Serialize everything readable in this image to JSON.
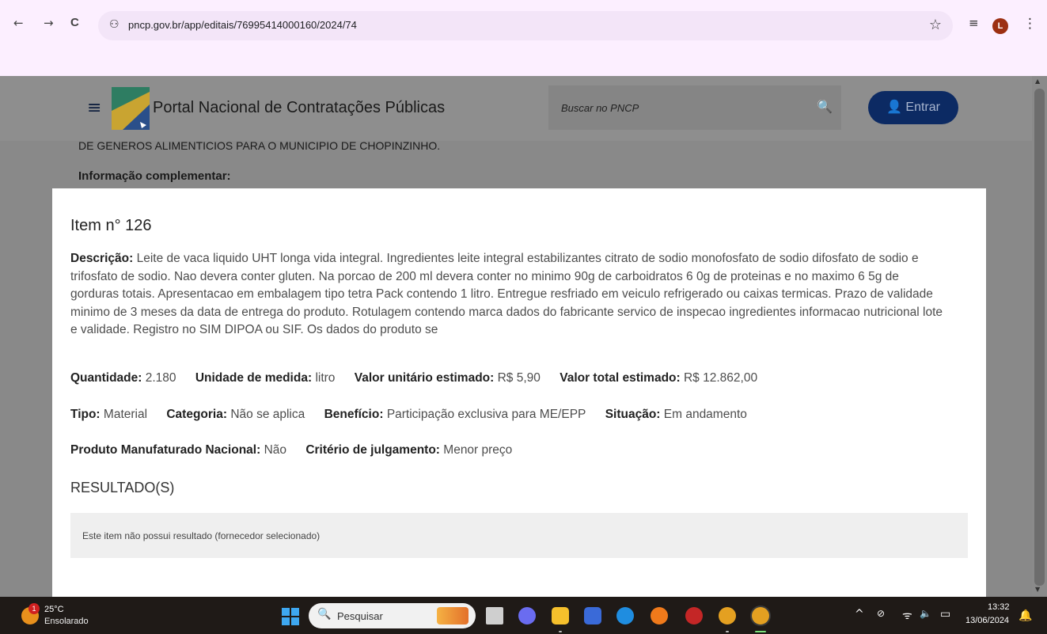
{
  "browser": {
    "url": "pncp.gov.br/app/editais/76995414000160/2024/74",
    "profile_initial": "L",
    "back_icon": "←",
    "forward_icon": "→",
    "reload_icon": "C",
    "tune_icon": "⚇",
    "star_icon": "☆",
    "reading_icon": "≡",
    "menu_icon": "⋮"
  },
  "header": {
    "menu_icon": "≡",
    "title": "Portal Nacional de Contratações Públicas",
    "search_placeholder": "Buscar no PNCP",
    "search_icon": "🔍",
    "login_label": "Entrar",
    "login_icon": "👤"
  },
  "background": {
    "partial_text": "DE GENEROS ALIMENTICIOS PARA O MUNICIPIO DE CHOPINZINHO.",
    "info_label": "Informação complementar:"
  },
  "modal": {
    "title": "Item n° 126",
    "description_label": "Descrição:",
    "description": "Leite de vaca liquido UHT longa vida integral. Ingredientes leite integral estabilizantes citrato de sodio monofosfato de sodio difosfato de sodio e trifosfato de sodio. Nao devera conter gluten. Na porcao de 200 ml devera conter no minimo 90g de carboidratos 6 0g de proteinas e no maximo 6 5g de gorduras totais. Apresentacao em embalagem tipo tetra Pack contendo 1 litro. Entregue resfriado em veiculo refrigerado ou caixas termicas. Prazo de validade minimo de 3 meses da data de entrega do produto. Rotulagem contendo marca dados do fabricante servico de inspecao ingredientes informacao nutricional lote e validade. Registro no SIM DIPOA ou SIF. Os dados do produto se",
    "quantidade_label": "Quantidade:",
    "quantidade": "2.180",
    "unidade_label": "Unidade de medida:",
    "unidade": "litro",
    "valor_unit_label": "Valor unitário estimado:",
    "valor_unit": "R$ 5,90",
    "valor_total_label": "Valor total estimado:",
    "valor_total": "R$ 12.862,00",
    "tipo_label": "Tipo:",
    "tipo": "Material",
    "categoria_label": "Categoria:",
    "categoria": "Não se aplica",
    "beneficio_label": "Benefício:",
    "beneficio": "Participação exclusiva para ME/EPP",
    "situacao_label": "Situação:",
    "situacao": "Em andamento",
    "produto_label": "Produto Manufaturado Nacional:",
    "produto": "Não",
    "criterio_label": "Critério de julgamento:",
    "criterio": "Menor preço",
    "resultado_heading": "RESULTADO(S)",
    "resultado_text": "Este item não possui resultado (fornecedor selecionado)"
  },
  "taskbar": {
    "weather_badge": "1",
    "weather_temp": "25°C",
    "weather_cond": "Ensolarado",
    "search_icon": "🔍",
    "search_placeholder": "Pesquisar",
    "tray_up": "^",
    "tray_wifi": "ᯤ",
    "tray_volume": "🔈",
    "tray_battery": "▭",
    "time": "13:32",
    "date": "13/06/2024",
    "bell_icon": "🔔",
    "colors": {
      "edge": "#1f8de0",
      "firefox": "#f07a1b",
      "chrome": "#e4a021"
    }
  }
}
